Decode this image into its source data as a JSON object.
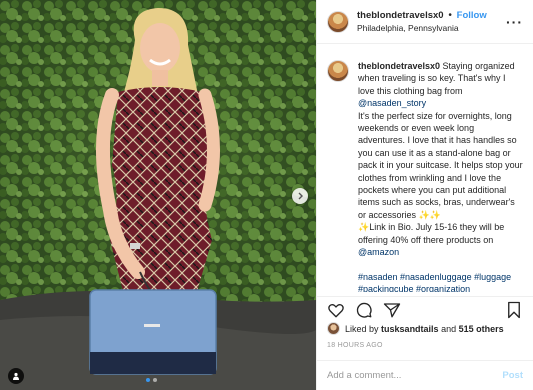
{
  "post": {
    "username": "theblondetravelsx0",
    "follow_label": "Follow",
    "separator": "•",
    "location": "Philadelphia, Pennsylvania",
    "more_label": "···"
  },
  "caption": {
    "username": "theblondetravelsx0",
    "text_1": "Staying organized when traveling is so key. That's why I love this clothing bag from",
    "mention_1": "@nasaden_story",
    "text_2": "It's the perfect size for overnights, long weekends or even week long adventures. I love that it has handles so you can use it as a stand-alone bag or pack it in your suitcase. It helps stop your clothes from wrinkling and I love the pockets where you can put additional items such as socks, bras, underwear's or accessories",
    "text_3": "✨Link in Bio. July 15-16 they will be offering 40% off there products on",
    "mention_2": "@amazon",
    "hashtags": "#nasaden #nasadenluggage #luggage #packingcube #organization #entrepreneur #entrepreneurlife"
  },
  "likes": {
    "prefix": "Liked by",
    "user": "tusksandtails",
    "conjunction": "and",
    "others": "515 others"
  },
  "timestamp": "18 HOURS AGO",
  "comment": {
    "placeholder": "Add a comment...",
    "post_label": "Post"
  },
  "icons": {
    "like": "heart-icon",
    "comment": "comment-icon",
    "share": "share-icon",
    "save": "bookmark-icon",
    "next": "chevron-right-icon",
    "tag": "user-tag-icon"
  },
  "colors": {
    "link": "#3897f0",
    "mention": "#003569",
    "post_disabled": "#b2dffc"
  },
  "carousel": {
    "current": 1,
    "total": 2
  }
}
